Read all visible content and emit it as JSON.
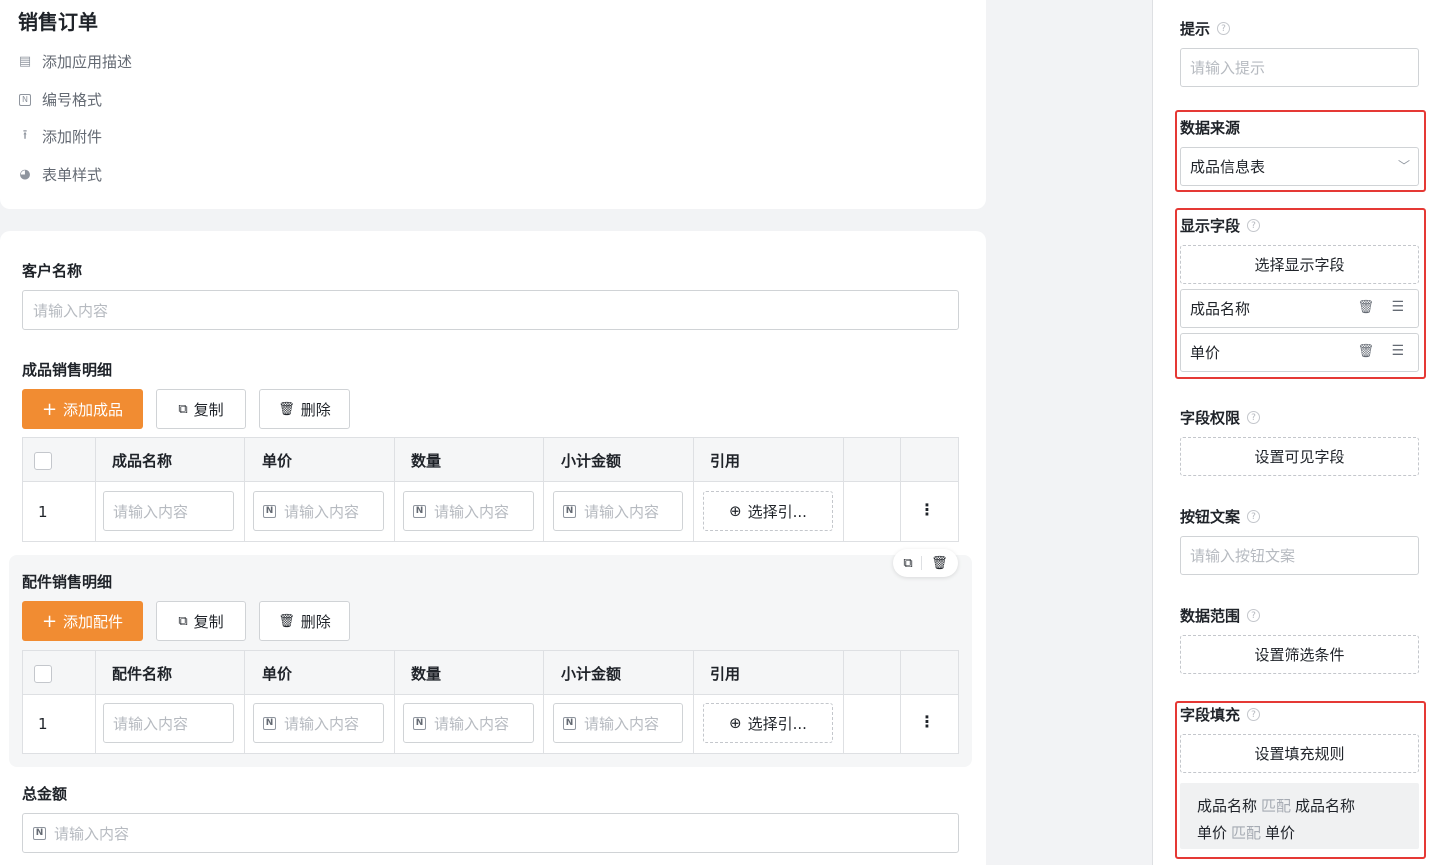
{
  "app": {
    "title": "销售订单",
    "meta": [
      {
        "icon": "comment-icon",
        "label": "添加应用描述"
      },
      {
        "icon": "number-format-icon",
        "label": "编号格式"
      },
      {
        "icon": "upload-icon",
        "label": "添加附件"
      },
      {
        "icon": "palette-icon",
        "label": "表单样式"
      }
    ]
  },
  "form": {
    "customer": {
      "label": "客户名称",
      "placeholder": "请输入内容"
    },
    "product_section": {
      "title": "成品销售明细",
      "add_label": "添加成品",
      "copy_label": "复制",
      "delete_label": "删除",
      "columns": [
        "成品名称",
        "单价",
        "数量",
        "小计金额",
        "引用"
      ],
      "row": {
        "index": "1",
        "placeholder": "请输入内容",
        "ref_label": "选择引..."
      }
    },
    "parts_section": {
      "title": "配件销售明细",
      "add_label": "添加配件",
      "copy_label": "复制",
      "delete_label": "删除",
      "columns": [
        "配件名称",
        "单价",
        "数量",
        "小计金额",
        "引用"
      ],
      "row": {
        "index": "1",
        "placeholder": "请输入内容",
        "ref_label": "选择引..."
      }
    },
    "total": {
      "label": "总金额",
      "placeholder": "请输入内容"
    }
  },
  "panel": {
    "hint": {
      "label": "提示",
      "placeholder": "请输入提示"
    },
    "data_source": {
      "label": "数据来源",
      "value": "成品信息表"
    },
    "display_fields": {
      "label": "显示字段",
      "select_label": "选择显示字段",
      "fields": [
        "成品名称",
        "单价"
      ]
    },
    "field_permission": {
      "label": "字段权限",
      "button": "设置可见字段"
    },
    "button_text": {
      "label": "按钮文案",
      "placeholder": "请输入按钮文案"
    },
    "data_range": {
      "label": "数据范围",
      "button": "设置筛选条件"
    },
    "field_fill": {
      "label": "字段填充",
      "button": "设置填充规则",
      "rules": [
        {
          "source": "成品名称",
          "match": "匹配",
          "target": "成品名称"
        },
        {
          "source": "单价",
          "match": "匹配",
          "target": "单价"
        }
      ]
    }
  },
  "colors": {
    "accent": "#f18c32",
    "highlight": "#e53935"
  }
}
